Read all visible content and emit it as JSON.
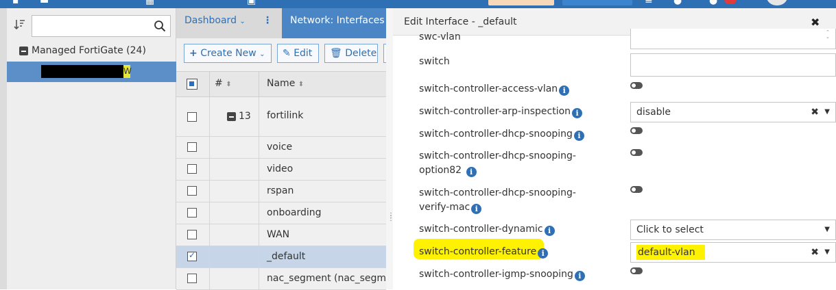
{
  "left_panel": {
    "search": {
      "value": "",
      "placeholder": ""
    },
    "tree_root_label": "Managed FortiGate (24)",
    "selected_device_suffix": "W"
  },
  "middle_panel": {
    "tabs": [
      {
        "label": "Dashboard"
      },
      {
        "label": "Network: Interfaces"
      }
    ],
    "toolbar": {
      "create_label": "Create New",
      "edit_label": "Edit",
      "delete_label": "Delete"
    },
    "table": {
      "headers": {
        "num": "#",
        "name": "Name"
      },
      "rows": [
        {
          "num": "13",
          "name": "fortilink",
          "expanded": true
        },
        {
          "num": "",
          "name": "voice"
        },
        {
          "num": "",
          "name": "video"
        },
        {
          "num": "",
          "name": "rspan"
        },
        {
          "num": "",
          "name": "onboarding"
        },
        {
          "num": "",
          "name": "WAN"
        },
        {
          "num": "",
          "name": "_default",
          "selected": true
        },
        {
          "num": "",
          "name": "nac_segment (nac_segmen"
        }
      ]
    }
  },
  "dialog": {
    "title": "Edit Interface - _default",
    "fields": [
      {
        "label": "swc-vlan",
        "type": "number",
        "value": ""
      },
      {
        "label": "switch",
        "type": "text",
        "value": ""
      },
      {
        "label": "switch-controller-access-vlan",
        "type": "toggle",
        "info": true,
        "value": "off"
      },
      {
        "label": "switch-controller-arp-inspection",
        "type": "select",
        "info": true,
        "value": "disable"
      },
      {
        "label": "switch-controller-dhcp-snooping",
        "type": "toggle",
        "info": true,
        "value": "off"
      },
      {
        "label": "switch-controller-dhcp-snooping-option82",
        "type": "toggle",
        "info": true,
        "value": "off"
      },
      {
        "label": "switch-controller-dhcp-snooping-verify-mac",
        "type": "toggle",
        "info": true,
        "value": "off"
      },
      {
        "label": "switch-controller-dynamic",
        "type": "select",
        "info": true,
        "value": "Click to select"
      },
      {
        "label": "switch-controller-feature",
        "type": "select",
        "info": true,
        "value": "default-vlan",
        "highlighted": true
      },
      {
        "label": "switch-controller-igmp-snooping",
        "type": "toggle",
        "info": true,
        "value": "off"
      }
    ]
  },
  "colors": {
    "brand_blue": "#2f6fb4",
    "tab_active": "#4a86c5",
    "highlight": "#fff200"
  }
}
